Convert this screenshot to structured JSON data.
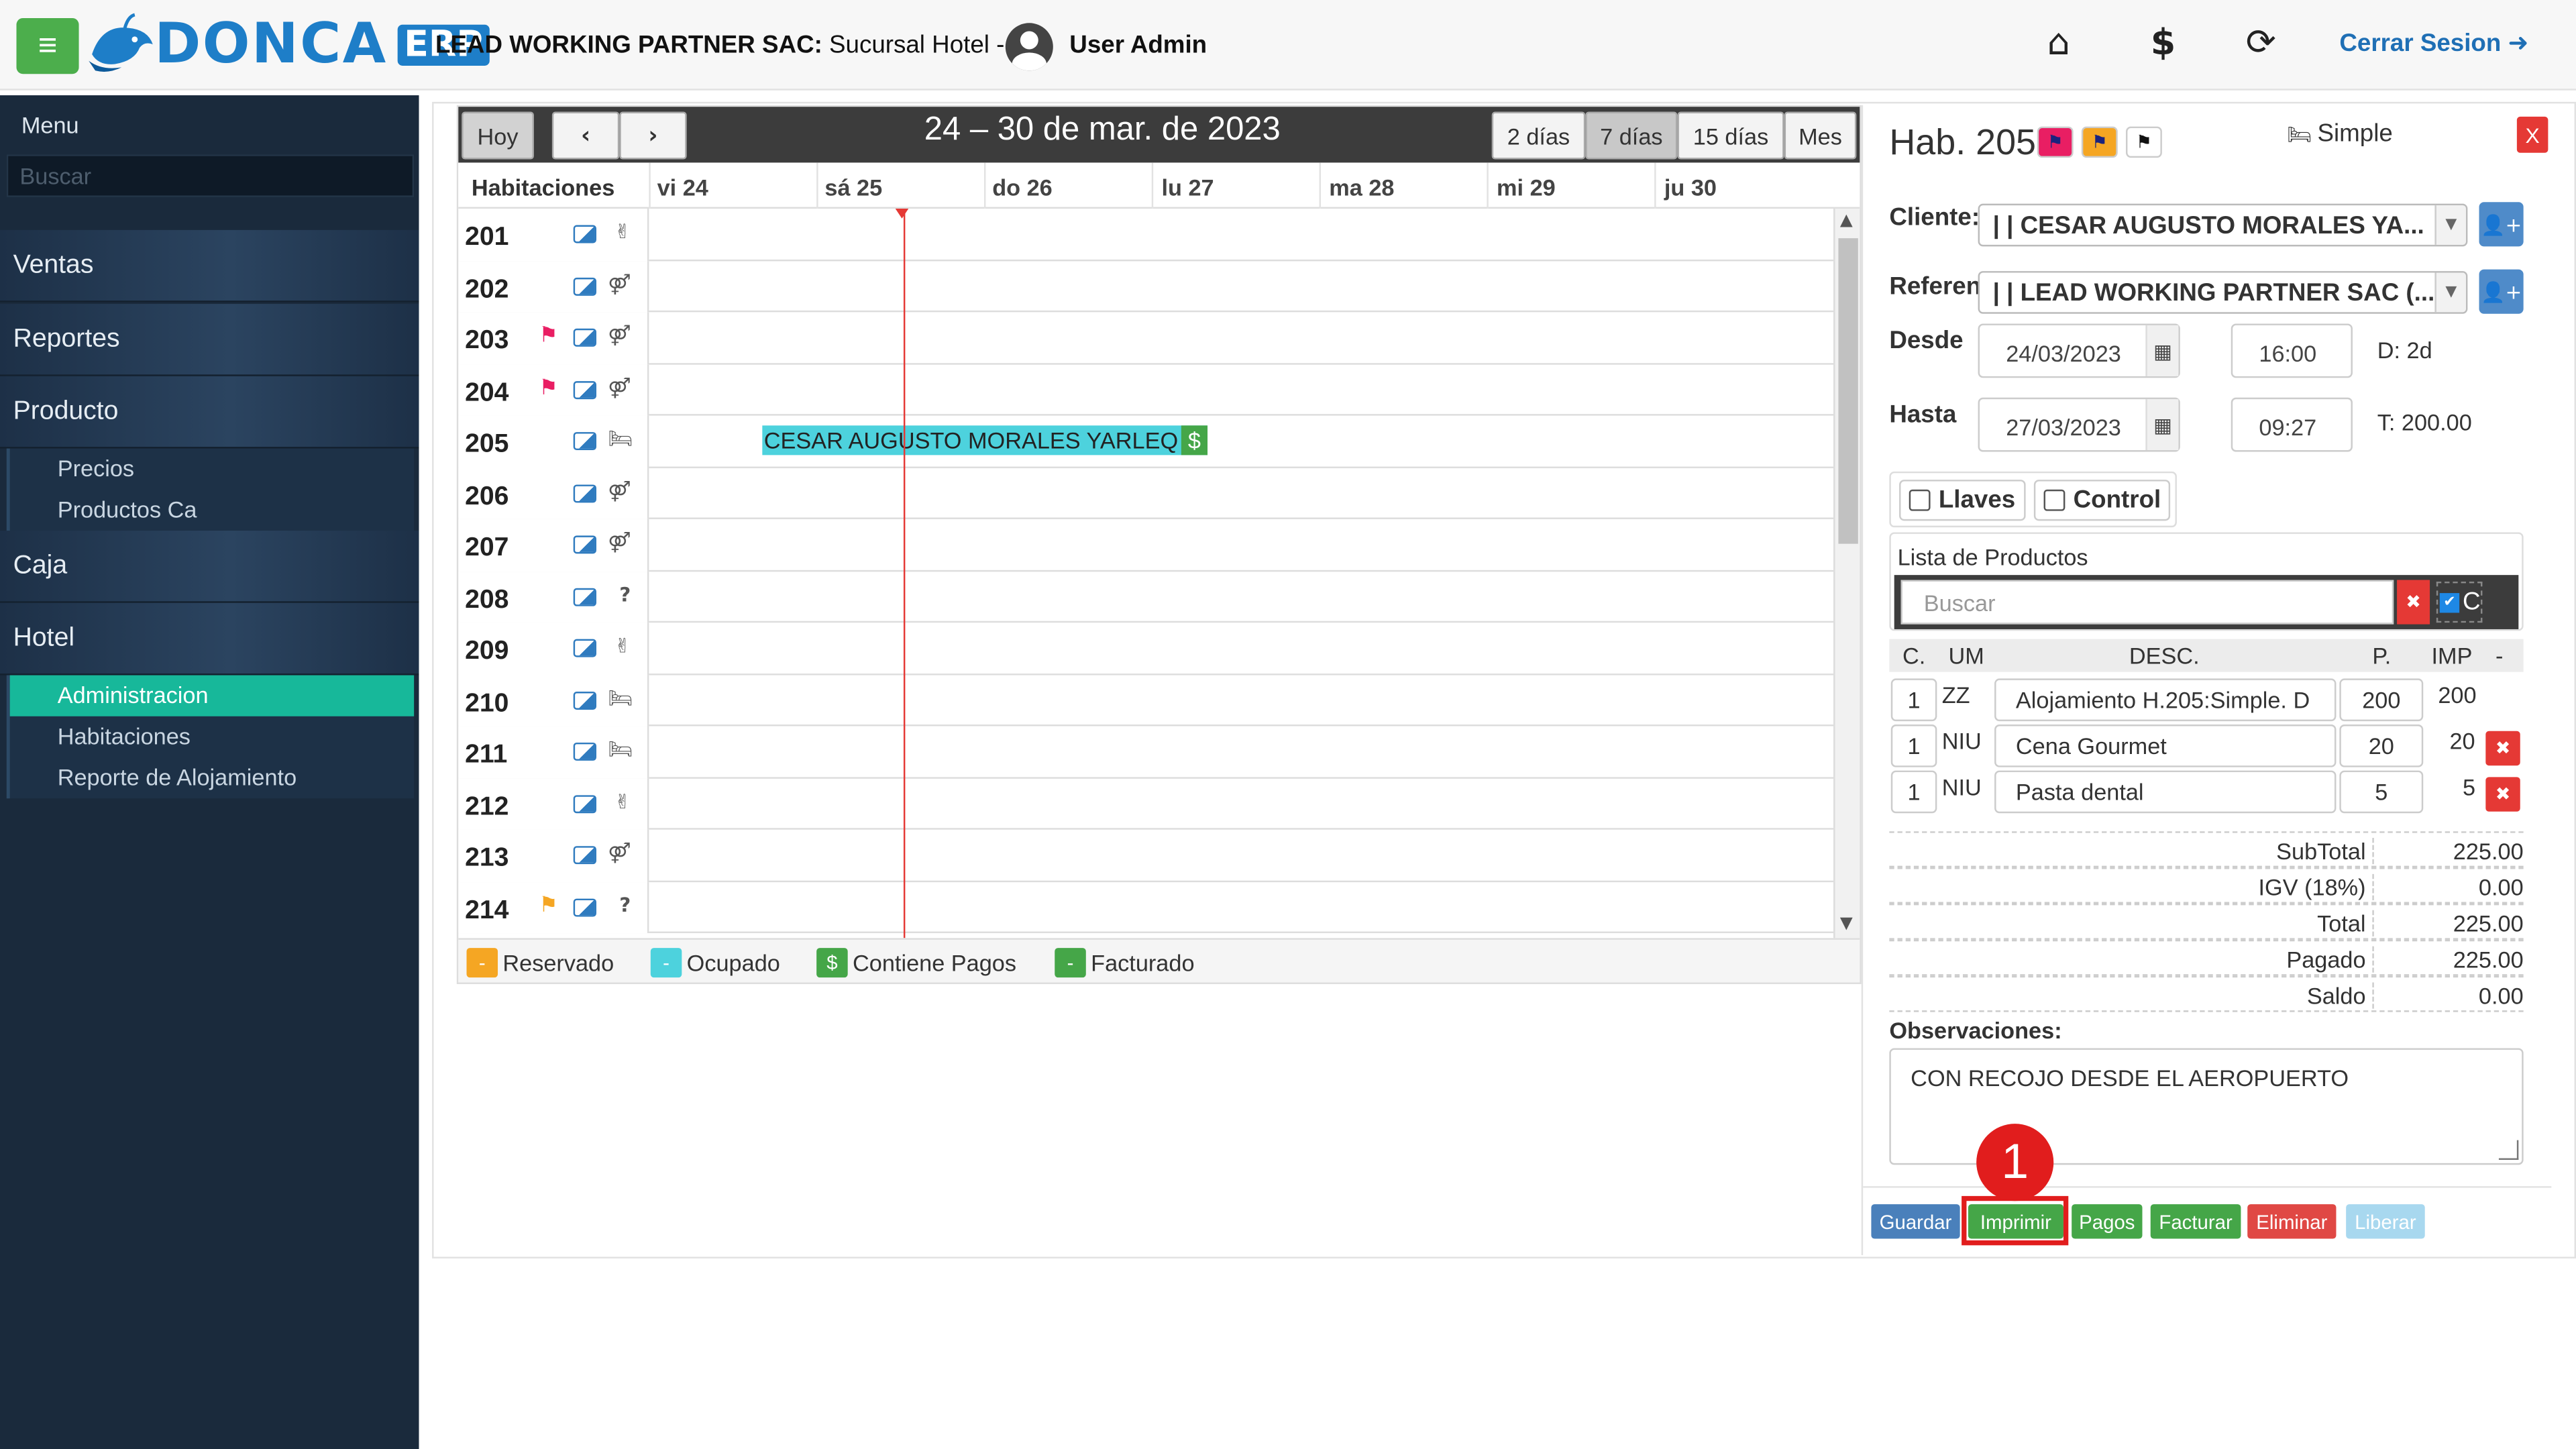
{
  "header": {
    "brand": "DONCA",
    "brand_suffix": "ERP",
    "company_bold": "LEAD WORKING PARTNER SAC:",
    "company_rest": " Sucursal Hotel -- |",
    "user": "User Admin",
    "logout": "Cerrar Sesion",
    "icons": [
      "home-icon",
      "dollar-icon",
      "lock-refresh-icon",
      "sign-out-icon"
    ]
  },
  "sidebar": {
    "menu_label": "Menu",
    "search_placeholder": "Buscar",
    "items": [
      "Ventas",
      "Reportes",
      "Producto",
      "Caja",
      "Hotel"
    ],
    "producto_sub": [
      "Precios",
      "Productos Ca"
    ],
    "hotel_sub": [
      "Administracion",
      "Habitaciones",
      "Reporte de Alojamiento"
    ],
    "active": "Administracion"
  },
  "calendar": {
    "today_btn": "Hoy",
    "title": "24 – 30 de mar. de 2023",
    "views": [
      "2 días",
      "7 días",
      "15 días",
      "Mes"
    ],
    "selected_view": "7 días",
    "rooms_header": "Habitaciones",
    "days": [
      "vi 24",
      "sá 25",
      "do 26",
      "lu 27",
      "ma 28",
      "mi 29",
      "ju 30"
    ],
    "rooms": [
      "201",
      "202",
      "203",
      "204",
      "205",
      "206",
      "207",
      "208",
      "209",
      "210",
      "211",
      "212",
      "213",
      "214"
    ],
    "booking": {
      "guest": "CESAR AUGUSTO MORALES YARLEQ",
      "pay_icon": "$"
    },
    "legend": [
      {
        "label": "Reservado",
        "color": "#f5a623",
        "mark": "-"
      },
      {
        "label": "Ocupado",
        "color": "#4dd2dd",
        "mark": "-"
      },
      {
        "label": "Contiene Pagos",
        "color": "#45a648",
        "mark": "$"
      },
      {
        "label": "Facturado",
        "color": "#45a648",
        "mark": "-"
      }
    ]
  },
  "detail": {
    "title": "Hab. 205",
    "type": "Simple",
    "close": "X",
    "cliente_label": "Cliente:",
    "cliente_value": "| | CESAR AUGUSTO MORALES YA...",
    "referencia_label": "Referencia:",
    "referencia_value": "| | LEAD WORKING PARTNER SAC (...",
    "desde_label": "Desde",
    "desde_date": "24/03/2023",
    "desde_time": "16:00",
    "days_info": "D: 2d",
    "hasta_label": "Hasta",
    "hasta_date": "27/03/2023",
    "hasta_time": "09:27",
    "total_info": "T: 200.00",
    "llaves": "Llaves",
    "control": "Control",
    "products_title": "Lista de Productos",
    "products_search_placeholder": "Buscar",
    "products_toggle": "C",
    "columns": [
      "C.",
      "UM",
      "DESC.",
      "P.",
      "IMP",
      "-"
    ],
    "products": [
      {
        "qty": "1",
        "um": "ZZ",
        "desc": "Alojamiento H.205:Simple. D",
        "price": "200",
        "imp": "200"
      },
      {
        "qty": "1",
        "um": "NIU",
        "desc": "Cena Gourmet",
        "price": "20",
        "imp": "20"
      },
      {
        "qty": "1",
        "um": "NIU",
        "desc": "Pasta dental",
        "price": "5",
        "imp": "5"
      }
    ],
    "totals": [
      {
        "label": "SubTotal",
        "value": "225.00"
      },
      {
        "label": "IGV (18%)",
        "value": "0.00"
      },
      {
        "label": "Total",
        "value": "225.00"
      },
      {
        "label": "Pagado",
        "value": "225.00"
      },
      {
        "label": "Saldo",
        "value": "0.00"
      }
    ],
    "obs_label": "Observaciones:",
    "obs_value": "CON RECOJO DESDE EL AEROPUERTO",
    "buttons": [
      "Guardar",
      "Imprimir",
      "Pagos",
      "Facturar",
      "Eliminar",
      "Liberar"
    ]
  },
  "annotation": {
    "step": "1"
  }
}
